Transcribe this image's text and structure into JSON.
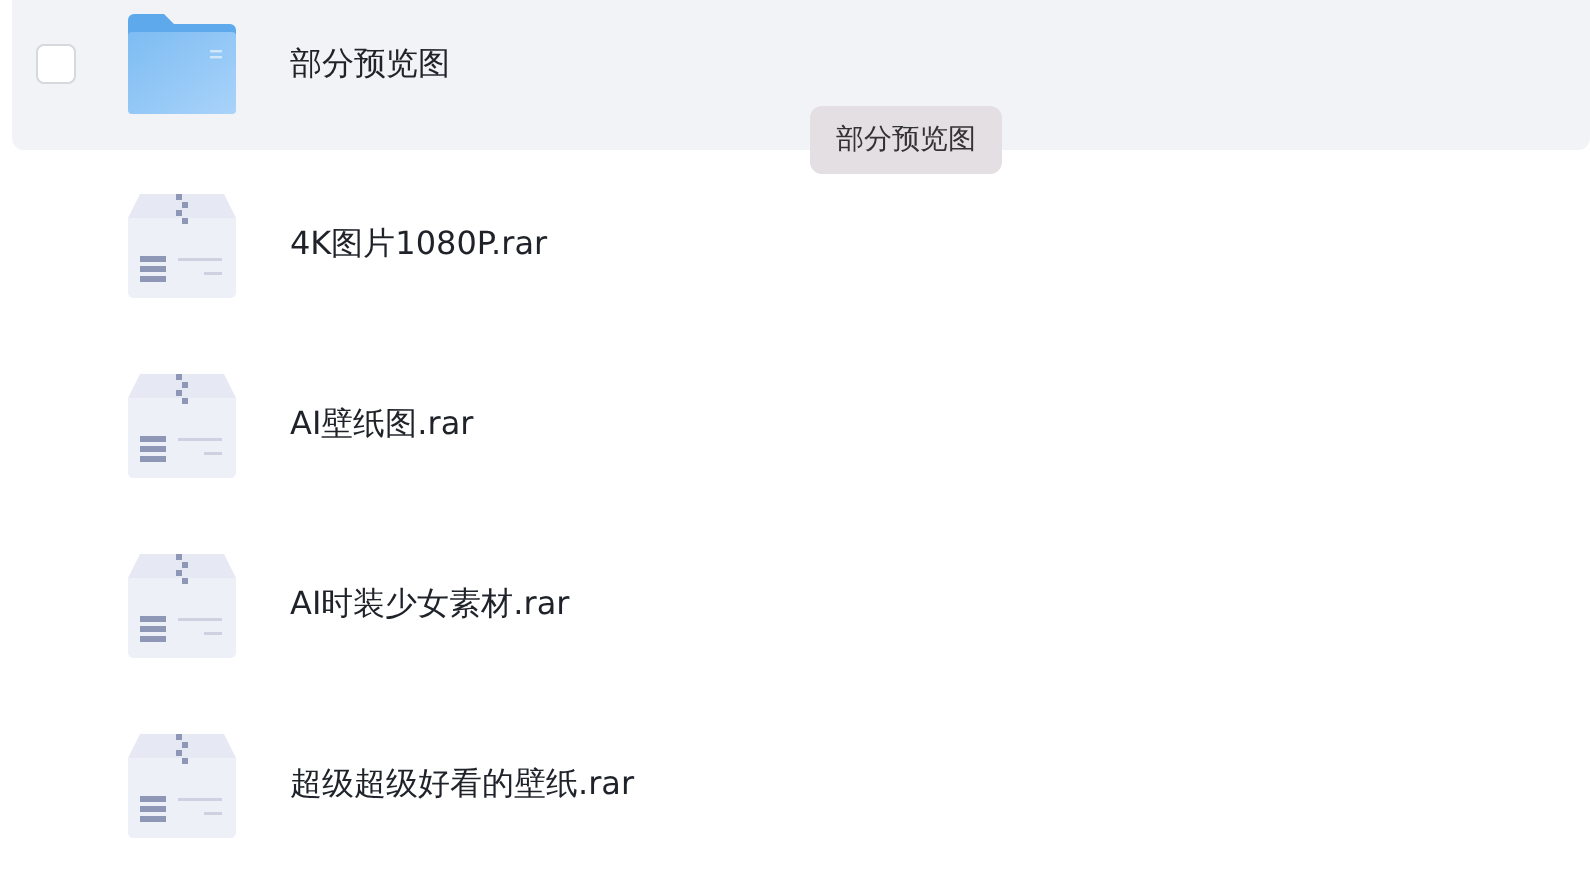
{
  "files": [
    {
      "kind": "folder",
      "name": "部分预览图",
      "hovered": true,
      "checked": false
    },
    {
      "kind": "archive",
      "name": "4K图片1080P.rar",
      "hovered": false,
      "checked": false
    },
    {
      "kind": "archive",
      "name": "AI壁纸图.rar",
      "hovered": false,
      "checked": false
    },
    {
      "kind": "archive",
      "name": "AI时装少女素材.rar",
      "hovered": false,
      "checked": false
    },
    {
      "kind": "archive",
      "name": "超级超级好看的壁纸.rar",
      "hovered": false,
      "checked": false
    }
  ],
  "tooltip": {
    "text": "部分预览图"
  }
}
